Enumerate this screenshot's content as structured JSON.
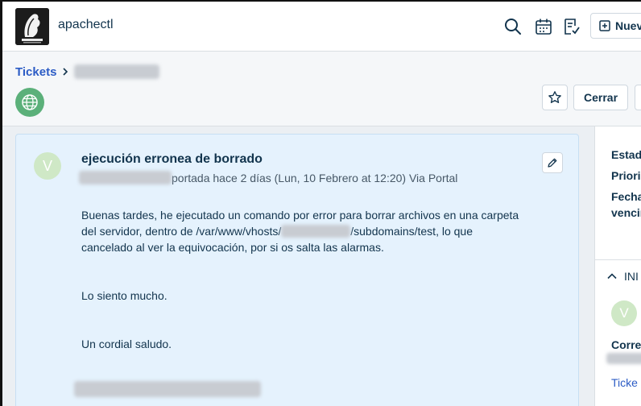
{
  "header": {
    "app_name": "apachectl",
    "new_button_label": "Nuev"
  },
  "breadcrumb": {
    "root_label": "Tickets"
  },
  "actions": {
    "close_label": "Cerrar"
  },
  "ticket": {
    "avatar_initial": "V",
    "subject": "ejecución erronea de borrado",
    "meta_text": "portada hace 2 días (Lun, 10 Febrero at 12:20) Via Portal",
    "body_line_1a": "Buenas tardes, he ejecutado un comando por error para borrar archivos en una carpeta",
    "body_line_2a": "del servidor, dentro de /var/www/vhosts/",
    "body_line_2b": "/subdomains/test, lo que",
    "body_line_3": "cancelado al ver la equivocación, por si os salta las alarmas.",
    "body_p2": "Lo siento mucho.",
    "body_p3": "Un cordial saludo."
  },
  "sidebar": {
    "status_label": "Estad",
    "priority_label": "Priori",
    "due_label_1": "Fecha",
    "due_label_2": "vencir",
    "info_label": "INI",
    "avatar_initial": "V",
    "email_label": "Corre",
    "tickets_link": "Ticke"
  },
  "colors": {
    "accent": "#2c5cc5",
    "globe": "#5bb07a",
    "card_bg": "#e5f2fd"
  }
}
